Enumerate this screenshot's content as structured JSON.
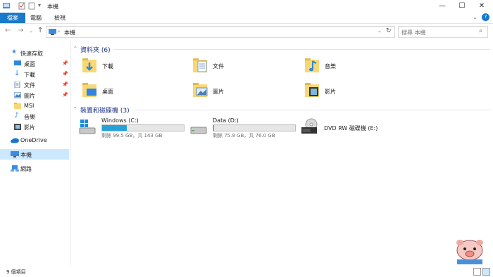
{
  "window": {
    "title": "本機",
    "controls": {
      "minimize": "—",
      "maximize": "☐",
      "close": "✕"
    }
  },
  "ribbon": {
    "tabs": [
      "檔案",
      "電腦",
      "檢視"
    ],
    "accent": "#1979ca",
    "help": "?"
  },
  "nav": {
    "address": "本機",
    "search_placeholder": "搜尋 本機"
  },
  "sidebar": {
    "quick_access": "快速存取",
    "items": [
      {
        "label": "桌面",
        "icon": "desktop-icon",
        "pinned": true
      },
      {
        "label": "下載",
        "icon": "download-icon",
        "pinned": true
      },
      {
        "label": "文件",
        "icon": "document-icon",
        "pinned": true
      },
      {
        "label": "圖片",
        "icon": "picture-icon",
        "pinned": true
      },
      {
        "label": "MSI",
        "icon": "folder-icon",
        "pinned": false
      },
      {
        "label": "音樂",
        "icon": "music-icon",
        "pinned": false
      },
      {
        "label": "影片",
        "icon": "video-icon",
        "pinned": false
      }
    ],
    "onedrive": "OneDrive",
    "this_pc": "本機",
    "network": "網路"
  },
  "main": {
    "folders_header": "資料夾 (6)",
    "folders": [
      {
        "name": "下載",
        "icon": "download-folder-icon"
      },
      {
        "name": "文件",
        "icon": "documents-folder-icon"
      },
      {
        "name": "音樂",
        "icon": "music-folder-icon"
      },
      {
        "name": "桌面",
        "icon": "desktop-folder-icon"
      },
      {
        "name": "圖片",
        "icon": "pictures-folder-icon"
      },
      {
        "name": "影片",
        "icon": "videos-folder-icon"
      }
    ],
    "devices_header": "裝置和磁碟機 (3)",
    "drives": [
      {
        "name": "Windows (C:)",
        "free": "剩餘 99.5 GB，共 143 GB",
        "used_fraction": 0.304,
        "icon": "windows-drive-icon"
      },
      {
        "name": "Data (D:)",
        "free": "剩餘 75.9 GB，共 76.0 GB",
        "used_fraction": 0.001,
        "icon": "hard-drive-icon"
      },
      {
        "name": "DVD RW 磁碟機 (E:)",
        "icon": "dvd-drive-icon"
      }
    ]
  },
  "status": {
    "items": "9 個項目"
  }
}
